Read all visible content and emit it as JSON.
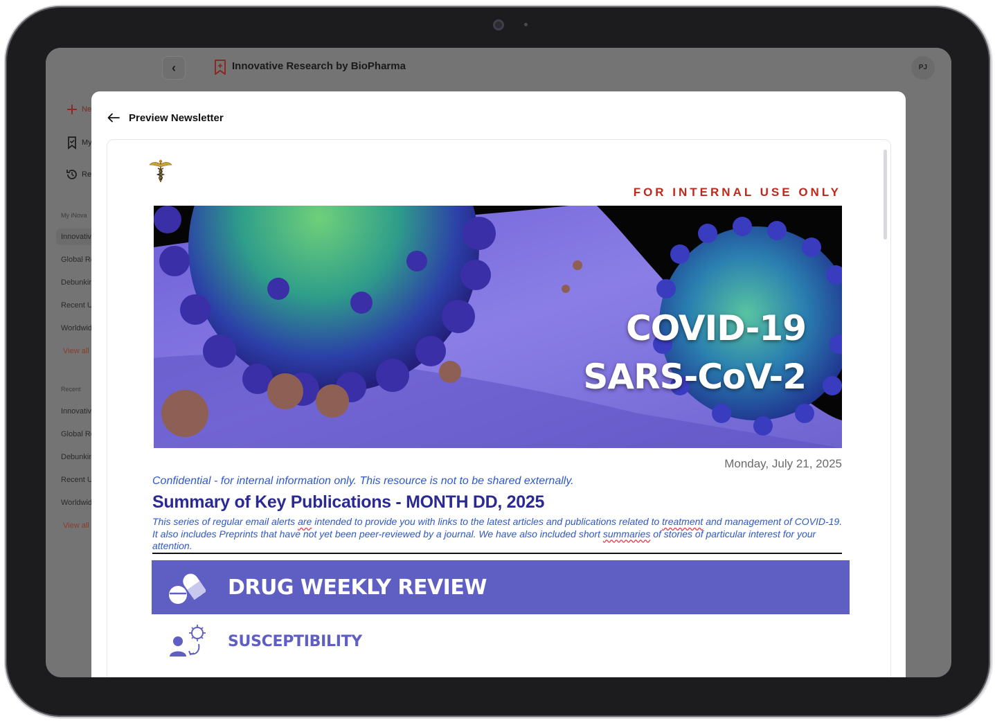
{
  "app": {
    "title": "Innovative Research by BioPharma",
    "avatar_initials": "PJ",
    "back_label": "‹"
  },
  "sidebar": {
    "actions": [
      {
        "label": "New",
        "icon": "plus-icon"
      },
      {
        "label": "My",
        "icon": "bookmark-icon"
      },
      {
        "label": "Recent",
        "icon": "history-icon"
      }
    ],
    "section_my": "My iNova",
    "my_items": [
      {
        "label": "Innovative Research",
        "active": true
      },
      {
        "label": "Global Research",
        "active": false
      },
      {
        "label": "Debunking",
        "active": false
      },
      {
        "label": "Recent Updates",
        "active": false
      },
      {
        "label": "Worldwide",
        "active": false
      }
    ],
    "view_all_1": "View all",
    "section_recent": "Recent",
    "recent_items": [
      {
        "label": "Innovative Research"
      },
      {
        "label": "Global Research"
      },
      {
        "label": "Debunking"
      },
      {
        "label": "Recent Updates"
      },
      {
        "label": "Worldwide"
      }
    ],
    "view_all_2": "View all"
  },
  "modal": {
    "title": "Preview Newsletter"
  },
  "newsletter": {
    "internal_label": "FOR INTERNAL USE ONLY",
    "banner_line1": "COVID-19",
    "banner_line2": "SARS-CoV-2",
    "date": "Monday, July 21, 2025",
    "confidential": "Confidential - for internal information only. This resource is not to be shared externally.",
    "summary_title": "Summary of Key Publications - MONTH DD, 2025",
    "summary_body": {
      "p1": "This series of regular email alerts ",
      "w1": "are",
      "p2": " intended to provide you with links to the latest articles and publications related to ",
      "w2": "treatment",
      "p3": " and management of COVID-19. It also includes Preprints that have not yet been peer-reviewed by a journal. We have also included short ",
      "w3": "summaries",
      "p4": " of stories of particular interest for your attention."
    },
    "section_title": "DRUG WEEKLY REVIEW",
    "subsection_title": "SUSCEPTIBILITY"
  },
  "colors": {
    "accent_purple": "#5f5fc3",
    "internal_red": "#c0261c",
    "body_blue": "#2e58c9",
    "title_navy": "#2a2a92"
  }
}
